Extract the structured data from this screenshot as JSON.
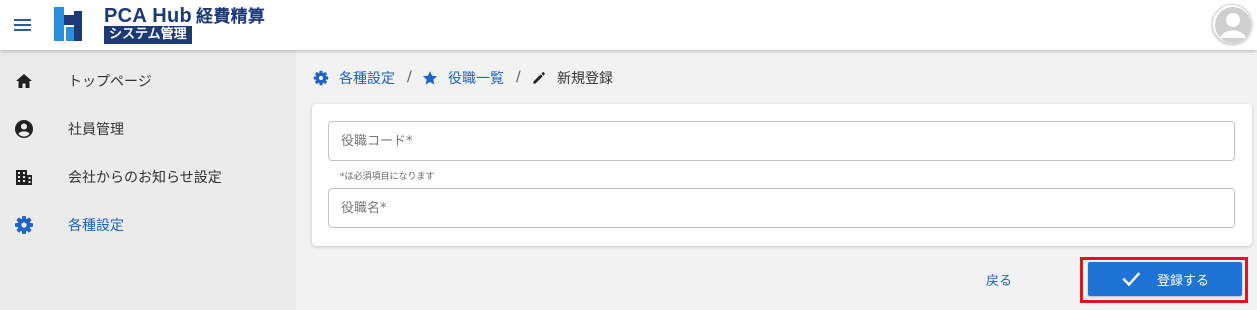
{
  "header": {
    "brand_name": "PCA Hub",
    "brand_product": "経費精算",
    "brand_subtitle": "システム管理",
    "menu_icon": "menu-icon",
    "logo_icon": "pca-hub-logo",
    "avatar_icon": "user-avatar-icon"
  },
  "sidebar": {
    "items": [
      {
        "label": "トップページ",
        "icon": "home-icon"
      },
      {
        "label": "社員管理",
        "icon": "account-circle-icon"
      },
      {
        "label": "会社からのお知らせ設定",
        "icon": "building-icon"
      },
      {
        "label": "各種設定",
        "icon": "gear-icon"
      }
    ],
    "active_index": 3
  },
  "breadcrumb": {
    "items": [
      {
        "label": "各種設定",
        "icon": "gear-icon"
      },
      {
        "label": "役職一覧",
        "icon": "star-icon"
      },
      {
        "label": "新規登録",
        "icon": "pencil-icon"
      }
    ],
    "separator": "/"
  },
  "form": {
    "code_field": {
      "placeholder": "役職コード*",
      "value": ""
    },
    "required_note": "*は必須項目になります",
    "name_field": {
      "placeholder": "役職名*",
      "value": ""
    }
  },
  "actions": {
    "back_label": "戻る",
    "submit_label": "登録する",
    "submit_icon": "check-icon"
  },
  "colors": {
    "accent": "#1f63c7",
    "brand_navy": "#1d3a78",
    "primary_button": "#1f73d6",
    "highlight": "#e0161a",
    "sidebar_bg": "#ebebeb",
    "page_bg": "#f2f2f2"
  }
}
